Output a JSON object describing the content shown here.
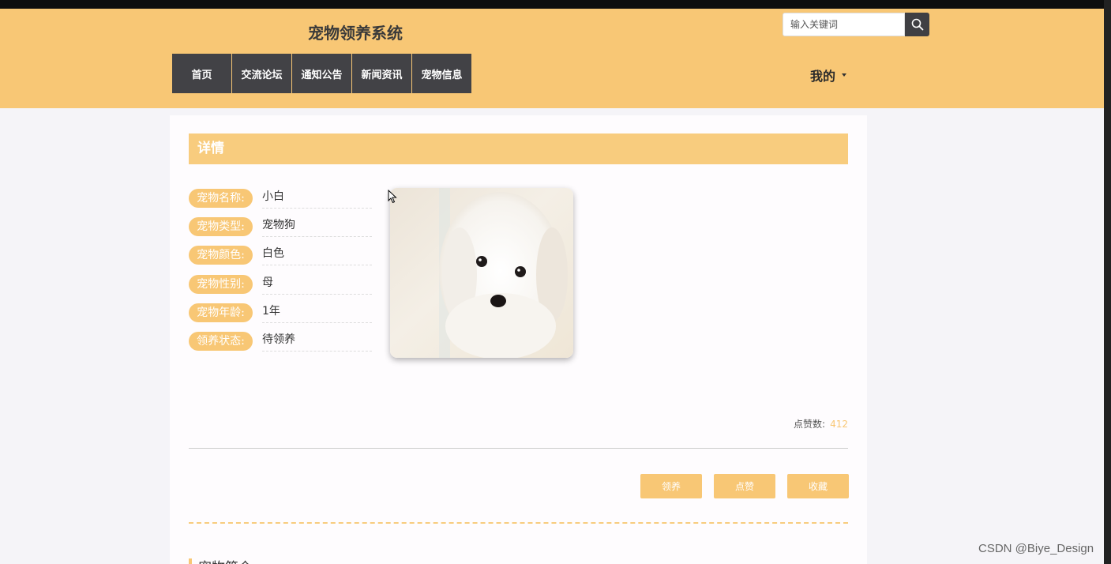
{
  "header": {
    "site_title": "宠物领养系统",
    "search_placeholder": "输入关键词",
    "nav": [
      "首页",
      "交流论坛",
      "通知公告",
      "新闻资讯",
      "宠物信息"
    ],
    "user_menu": "我的"
  },
  "detail": {
    "section_title": "详情",
    "fields": [
      {
        "label": "宠物名称:",
        "value": "小白"
      },
      {
        "label": "宠物类型:",
        "value": "宠物狗"
      },
      {
        "label": "宠物颜色:",
        "value": "白色"
      },
      {
        "label": "宠物性别:",
        "value": "母"
      },
      {
        "label": "宠物年龄:",
        "value": "1年"
      },
      {
        "label": "领养状态:",
        "value": "待领养"
      }
    ],
    "likes_label": "点赞数:",
    "likes_count": "412",
    "actions": {
      "adopt": "领养",
      "like": "点赞",
      "favorite": "收藏"
    },
    "intro_title": "宠物简介"
  },
  "watermark": "CSDN @Biye_Design",
  "colors": {
    "accent": "#f8c775",
    "nav_bg": "#424246",
    "page_bg": "#f5f4f8"
  },
  "icons": {
    "search": "search-icon",
    "cursor": "mouse-cursor-icon"
  }
}
